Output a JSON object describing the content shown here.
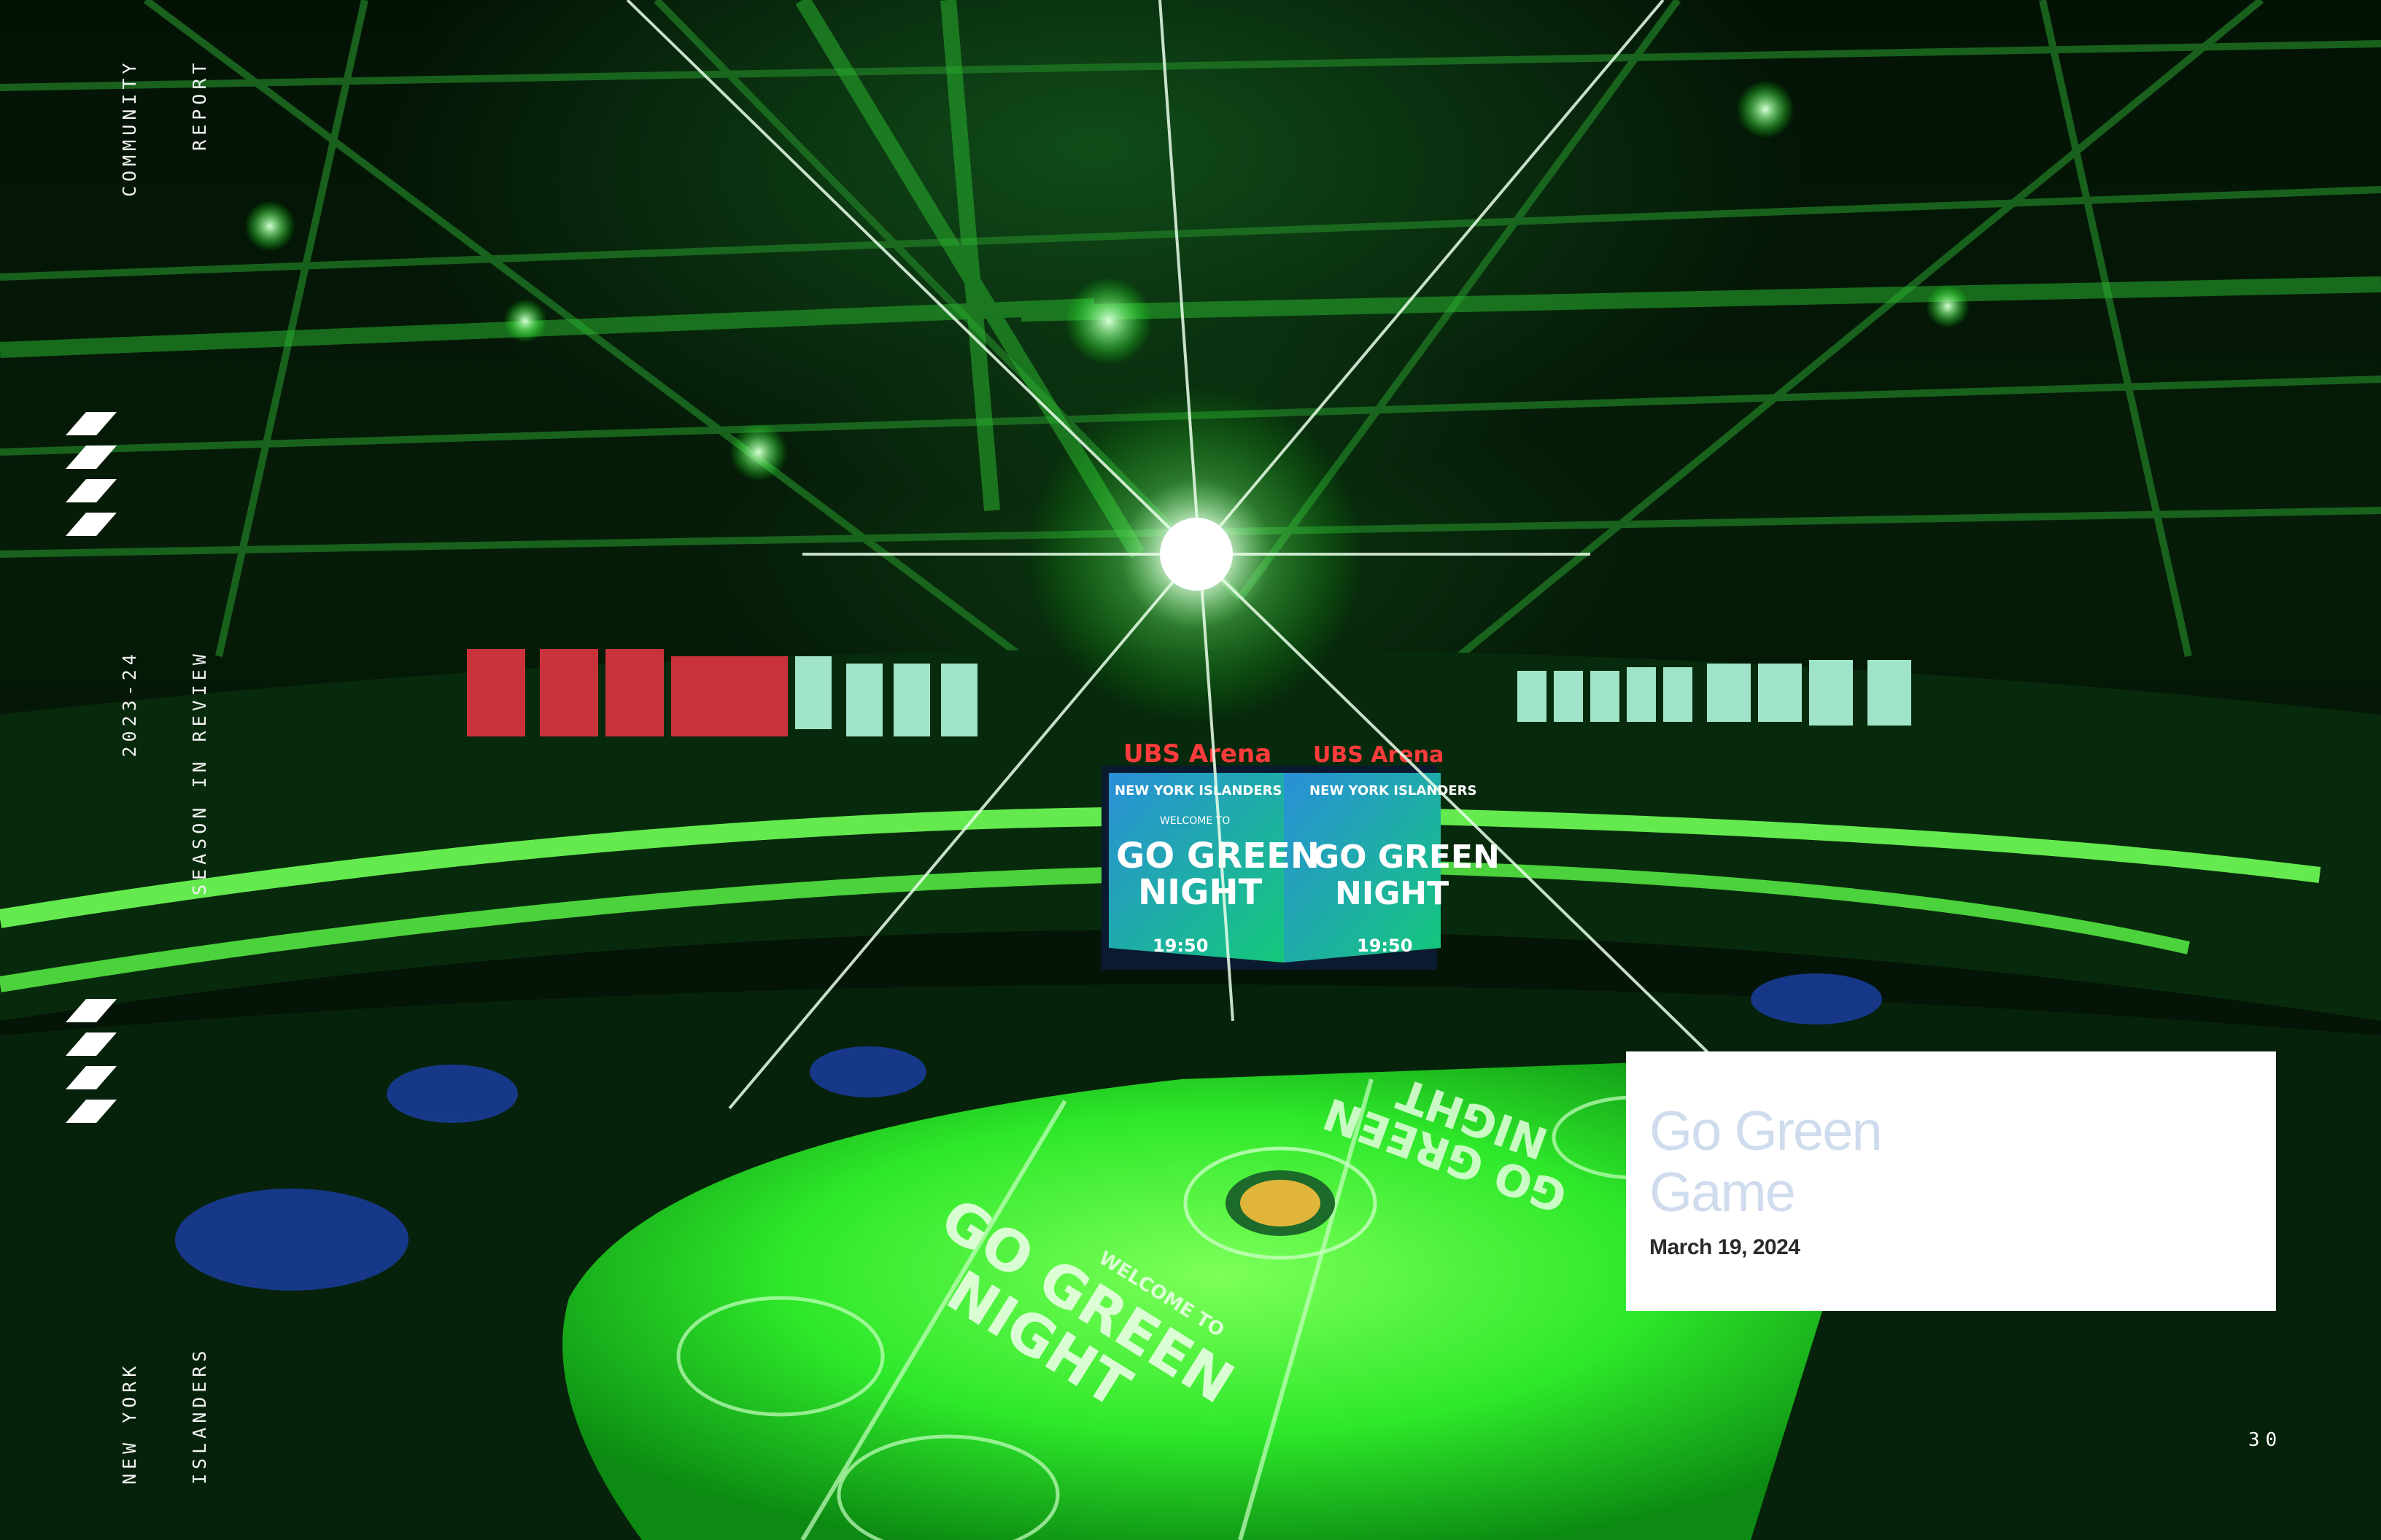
{
  "sidebar": {
    "report_line1": "COMMUNITY",
    "report_line2": "REPORT",
    "season_line1": "2023-24",
    "season_line2": "SEASON IN REVIEW",
    "team_line1": "NEW YORK",
    "team_line2": "ISLANDERS"
  },
  "photo": {
    "scoreboard_top": "NEW YORK ISLANDERS",
    "scoreboard_welcome": "WELCOME TO",
    "scoreboard_main_1": "GO GREEN",
    "scoreboard_main_2": "NIGHT",
    "scoreboard_clock": "19:50",
    "arena_sign": "UBS Arena",
    "ice_text_1": "GO GREEN",
    "ice_text_2": "NIGHT",
    "ice_welcome": "WELCOME TO"
  },
  "callout": {
    "title_line1": "Go Green",
    "title_line2": "Game",
    "date": "March 19, 2024"
  },
  "page_number": "30",
  "colors": {
    "accent_green": "#39ff3a",
    "callout_title": "#cfdced",
    "callout_bg": "#ffffff"
  }
}
